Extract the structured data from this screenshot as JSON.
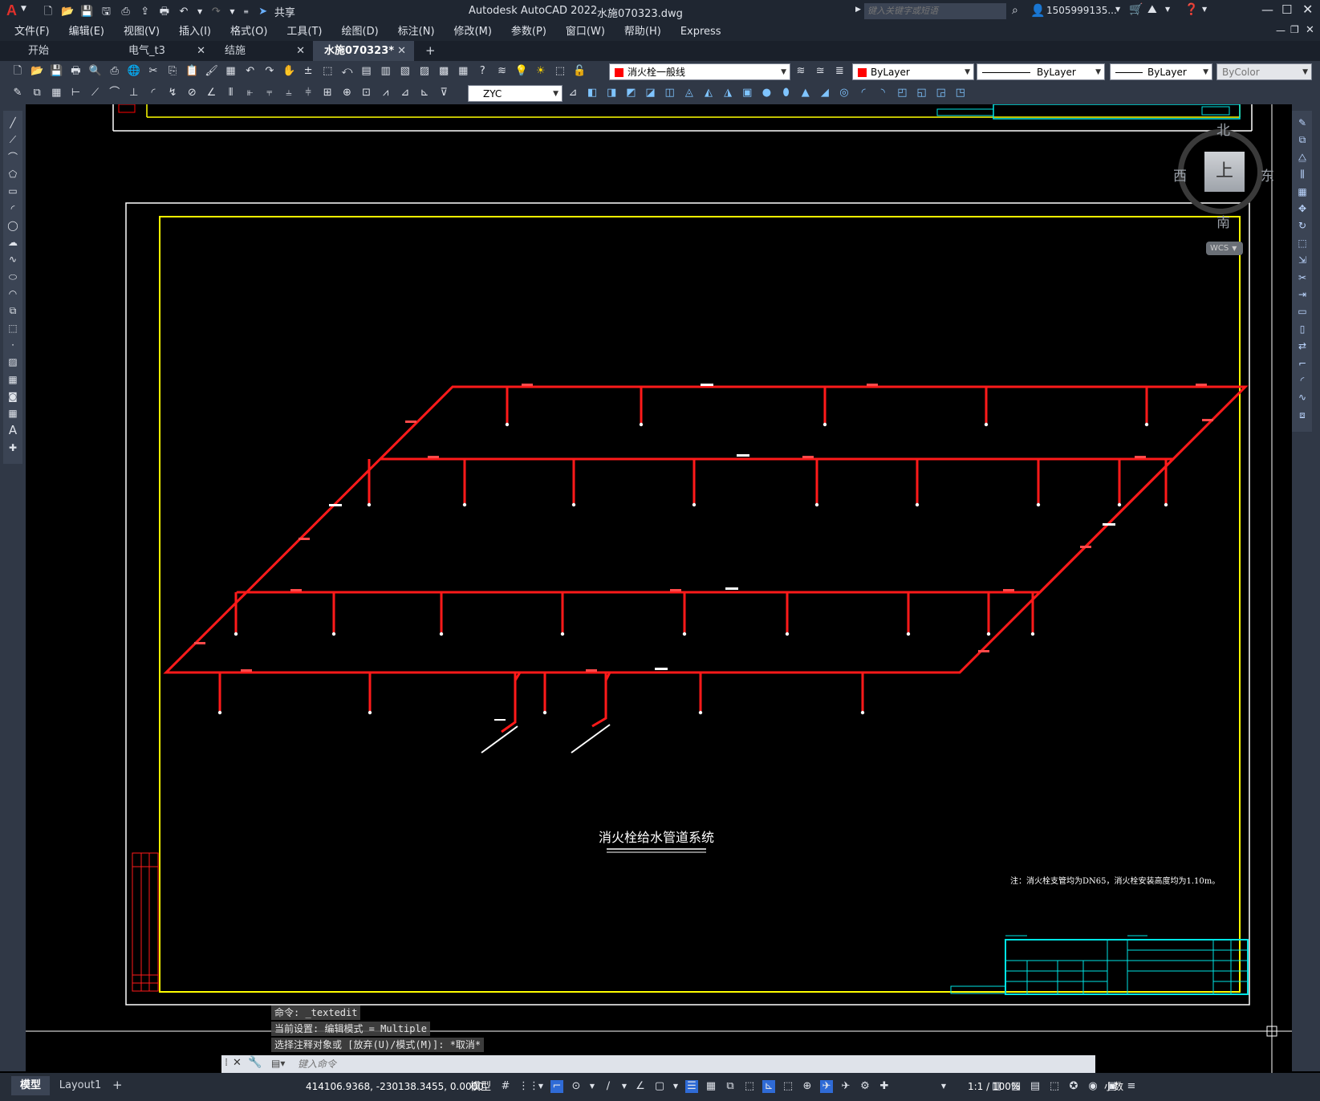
{
  "app": {
    "title": "Autodesk AutoCAD 2022",
    "filename": "水施070323.dwg",
    "share_label": "共享",
    "search_placeholder": "键入关键字或短语",
    "user": "1505999135...",
    "logo": "A"
  },
  "menu": [
    "文件(F)",
    "编辑(E)",
    "视图(V)",
    "插入(I)",
    "格式(O)",
    "工具(T)",
    "绘图(D)",
    "标注(N)",
    "修改(M)",
    "参数(P)",
    "窗口(W)",
    "帮助(H)",
    "Express"
  ],
  "tabs": [
    {
      "label": "开始",
      "active": false,
      "closable": false
    },
    {
      "label": "电气_t3",
      "active": false,
      "closable": true
    },
    {
      "label": "结施",
      "active": false,
      "closable": true
    },
    {
      "label": "水施070323*",
      "active": true,
      "closable": true
    }
  ],
  "tab_add": "+",
  "toolbar": {
    "layer": "消火栓一般线",
    "layer_color": "#ff0000",
    "color": "ByLayer",
    "color_swatch": "#ff0000",
    "linetype": "ByLayer",
    "lineweight": "ByLayer",
    "plotstyle": "ByColor",
    "textstyle": "ZYC"
  },
  "viewcube": {
    "north": "北",
    "south": "南",
    "east": "东",
    "west": "西",
    "top": "上",
    "wcs": "WCS"
  },
  "drawing": {
    "title": "消火栓给水管道系统",
    "note": "注：消火栓支管均为DN65，消火栓安装高度均为1.10m。",
    "colors": {
      "pipe": "#ff1a1a",
      "frame": "#ffff00",
      "border": "#ffffff",
      "titleblock": "#00e5e5",
      "annotation": "#ffffff"
    }
  },
  "command_history": [
    "命令: _textedit",
    "当前设置: 编辑模式 = Multiple",
    "选择注释对象或 [放弃(U)/模式(M)]: *取消*"
  ],
  "command_placeholder": "键入命令",
  "layout_tabs": [
    {
      "label": "模型",
      "active": true
    },
    {
      "label": "Layout1",
      "active": false
    }
  ],
  "layout_add": "+",
  "status": {
    "coords": "414106.9368, -230138.3455, 0.0000",
    "space": "模型",
    "scale": "1:1 / 100%",
    "units": "小数"
  }
}
